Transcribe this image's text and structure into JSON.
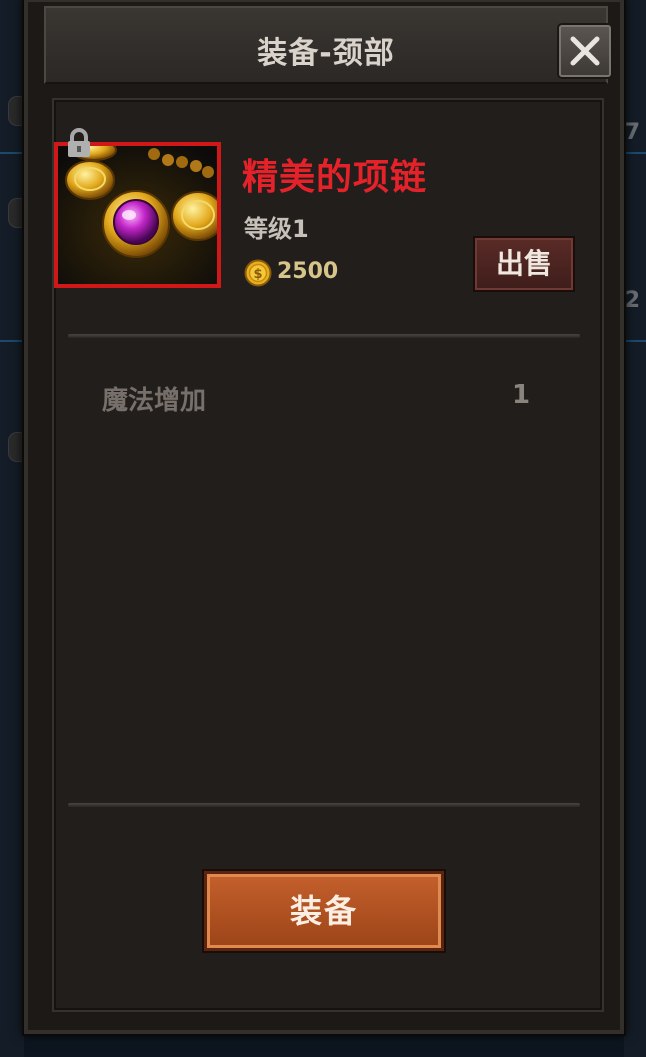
{
  "dialog": {
    "title": "装备-颈部",
    "close_icon": "close-icon"
  },
  "item": {
    "name": "精美的项链",
    "level_text": "等级1",
    "price": "2500",
    "price_icon": "gold-coin-icon",
    "lock_icon": "lock-icon",
    "name_color": "#e5222a",
    "frame_color": "#d01818"
  },
  "actions": {
    "sell_label": "出售",
    "equip_label": "装备"
  },
  "stats": [
    {
      "label": "魔法增加",
      "value": "1"
    }
  ],
  "background": {
    "side_numbers": [
      "7",
      "2"
    ]
  }
}
